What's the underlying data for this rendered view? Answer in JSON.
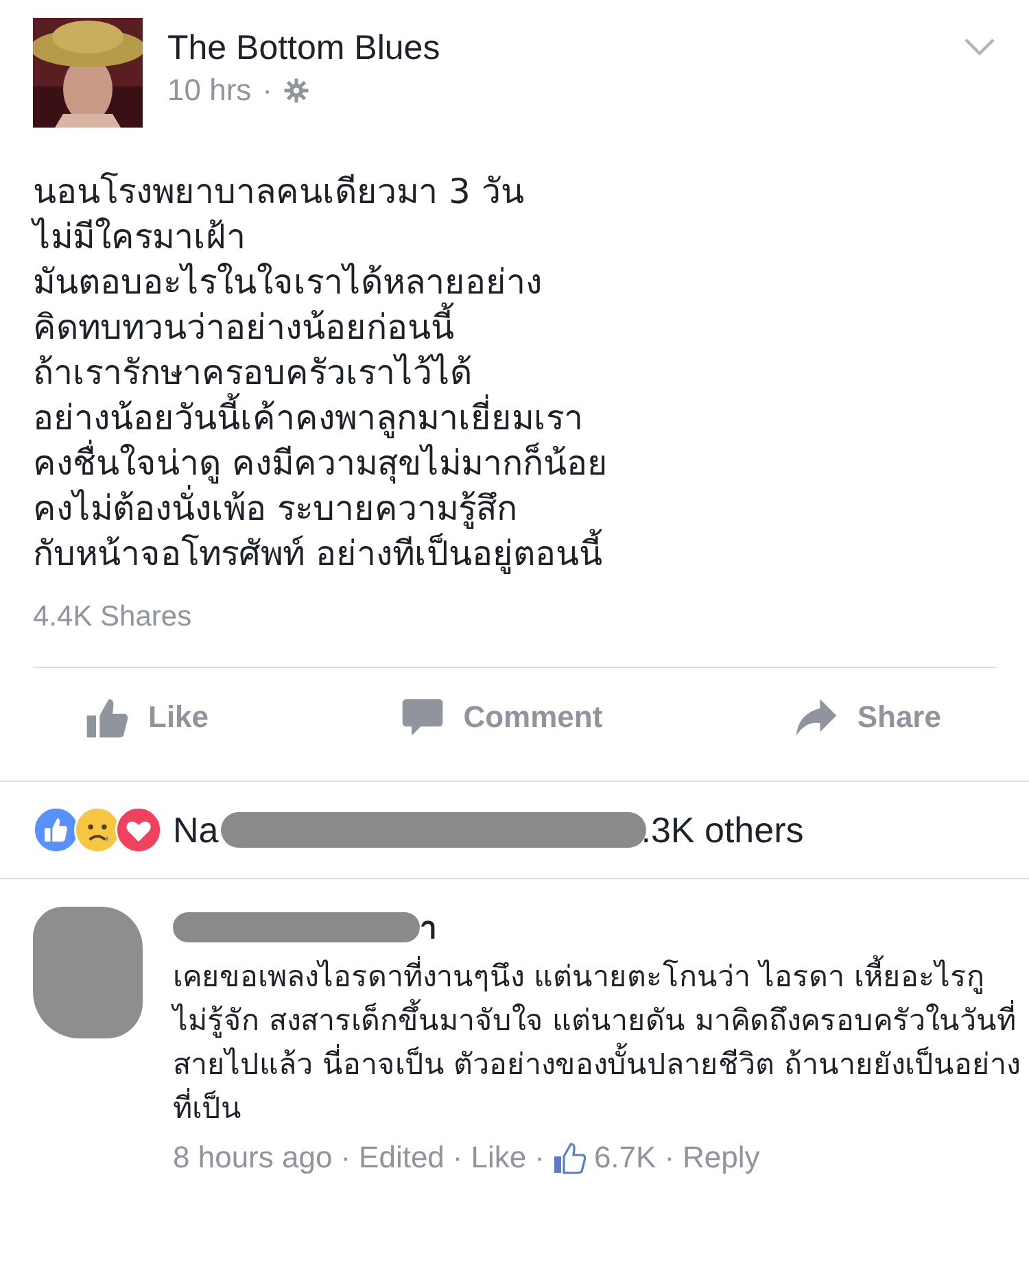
{
  "post": {
    "author": "The Bottom Blues",
    "time": "10 hrs",
    "separator": "·",
    "lines": [
      "นอนโรงพยาบาลคนเดียวมา 3 วัน",
      "ไม่มีใครมาเฝ้า",
      "มันตอบอะไรในใจเราได้หลายอย่าง",
      "คิดทบทวนว่าอย่างน้อยก่อนนี้",
      "ถ้าเรารักษาครอบครัวเราไว้ได้",
      "อย่างน้อยวันนี้เค้าคงพาลูกมาเยี่ยมเรา",
      "คงชื่นใจน่าดู คงมีความสุขไม่มากก็น้อย",
      "คงไม่ต้องนั่งเพ้อ ระบายความรู้สึก",
      "กับหน้าจอโทรศัพท์ อย่างทีเป็นอยู่ตอนนี้"
    ],
    "shares": "4.4K Shares"
  },
  "actions": [
    {
      "kind": "like",
      "label": "Like"
    },
    {
      "kind": "comment",
      "label": "Comment"
    },
    {
      "kind": "share",
      "label": "Share"
    }
  ],
  "reactions": {
    "text_start": "Na",
    "text_end": ".3K others"
  },
  "comment": {
    "author_end": "า",
    "text": "เคยขอเพลงไอรดาที่งานๆนึง แต่นายตะโกนว่า ไอรดา เหี้ยอะไรกูไม่รู้จัก สงสารเด็กขึ้นมาจับใจ แต่นายดัน มาคิดถึงครอบครัวในวันที่สายไปแล้ว นี่อาจเป็น ตัวอย่างของบั้นปลายชีวิต ถ้านายยังเป็นอย่างที่เป็น",
    "meta": [
      {
        "kind": "text",
        "text": "8 hours ago"
      },
      {
        "kind": "link",
        "text": "Edited"
      },
      {
        "kind": "link",
        "text": "Like"
      },
      {
        "kind": "likes",
        "text": "6.7K"
      },
      {
        "kind": "link",
        "text": "Reply"
      }
    ],
    "separator": "·"
  }
}
